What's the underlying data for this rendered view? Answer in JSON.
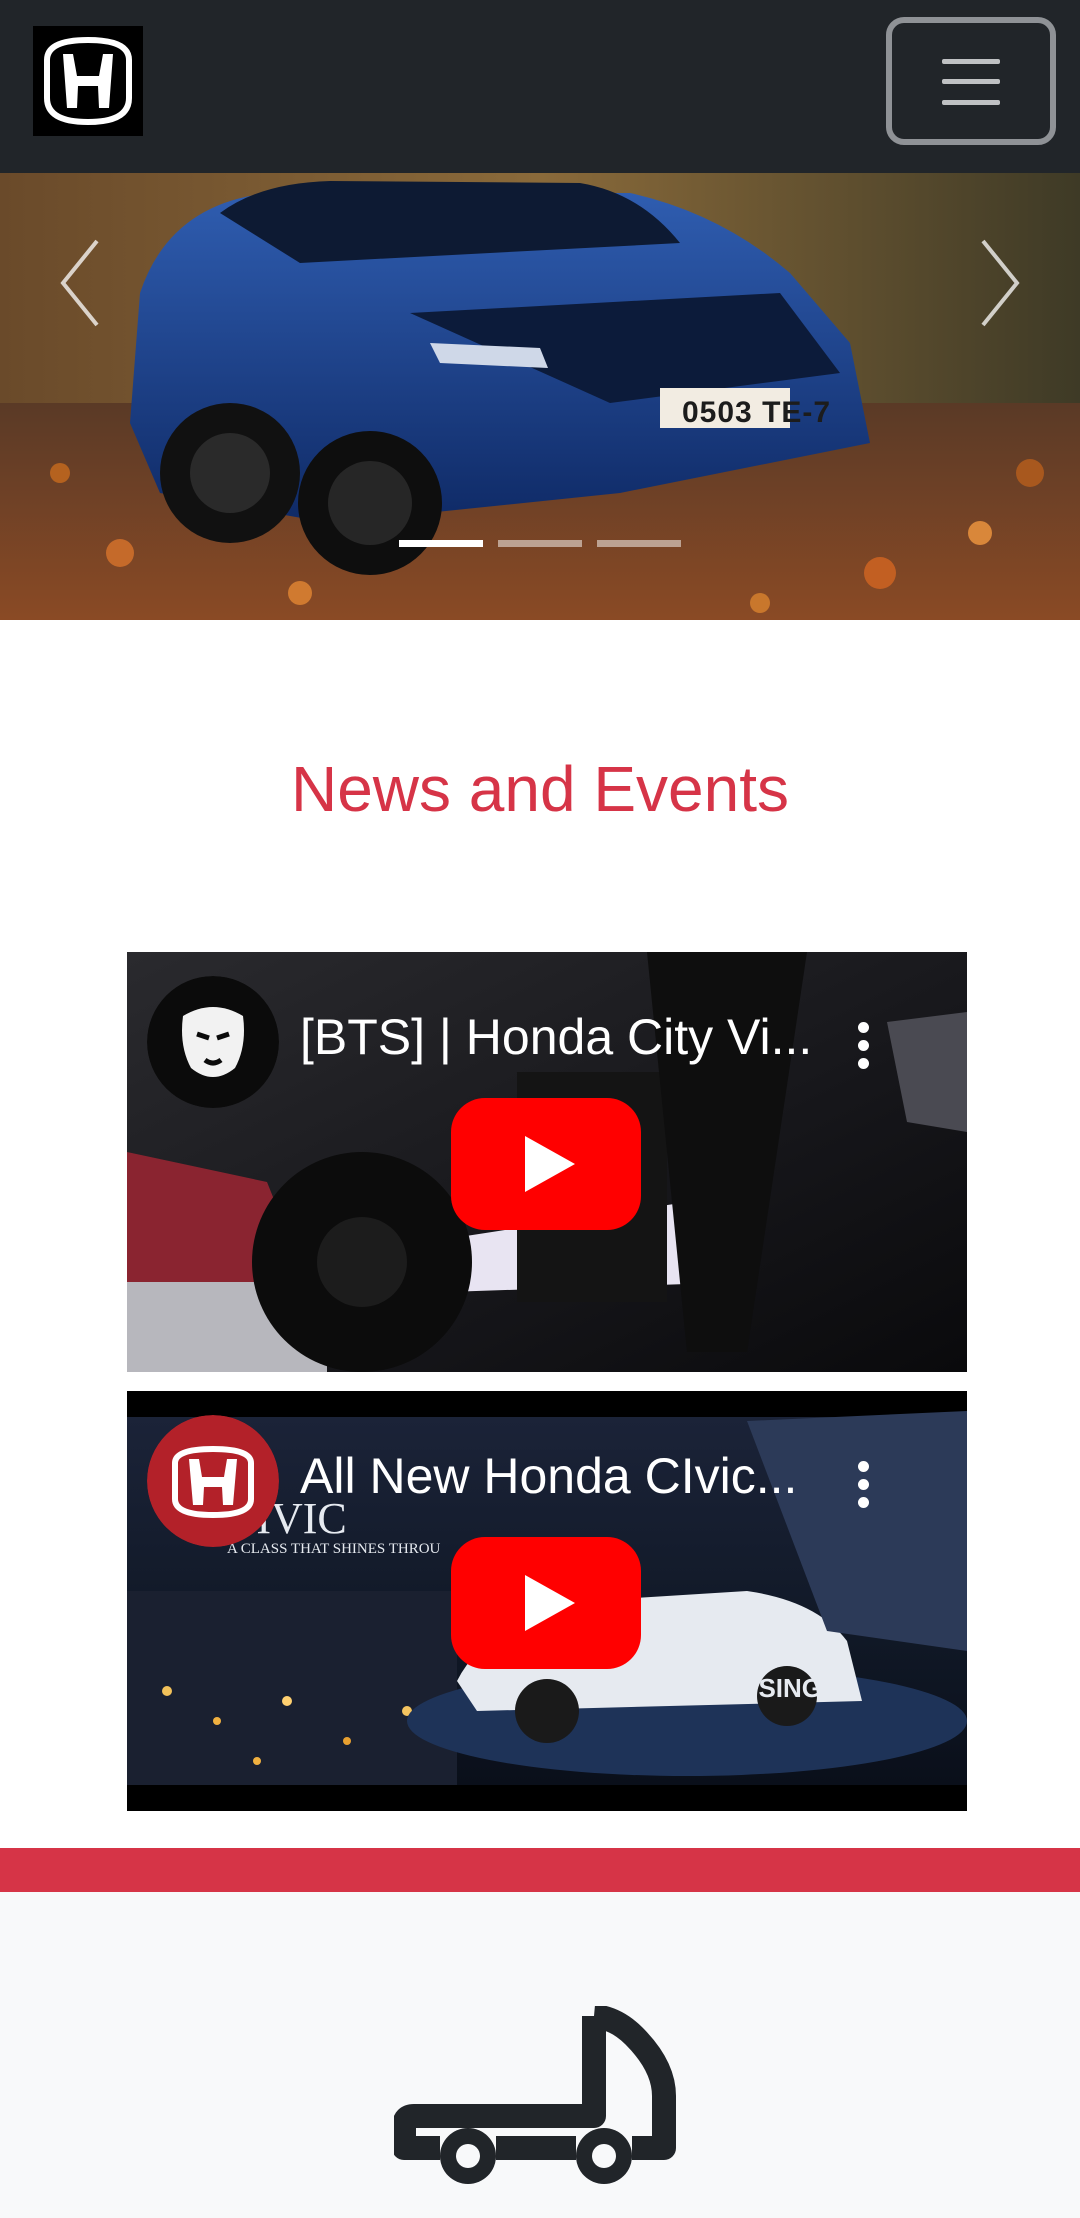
{
  "navbar": {
    "logo_icon": "honda-h-logo-icon",
    "menu_icon": "hamburger-menu-icon"
  },
  "carousel": {
    "prev_icon": "chevron-left-icon",
    "next_icon": "chevron-right-icon",
    "plate_text": "0503 TE-7",
    "slides_count": 3,
    "active_slide": 1
  },
  "news": {
    "title": "News and Events",
    "videos": [
      {
        "title": "[BTS] | Honda City Vi...",
        "channel_icon": "lion-head-icon",
        "play_icon": "youtube-play-icon",
        "menu_icon": "more-vertical-icon"
      },
      {
        "title": "All New Honda CIvic...",
        "channel_icon": "honda-h-logo-icon",
        "play_icon": "youtube-play-icon",
        "menu_icon": "more-vertical-icon"
      }
    ]
  },
  "features": {
    "icon": "truck-icon"
  },
  "colors": {
    "navbar_bg": "#212529",
    "accent_red": "#d63447",
    "light_bg": "#f8f9fa",
    "youtube_red": "#ff0000"
  }
}
